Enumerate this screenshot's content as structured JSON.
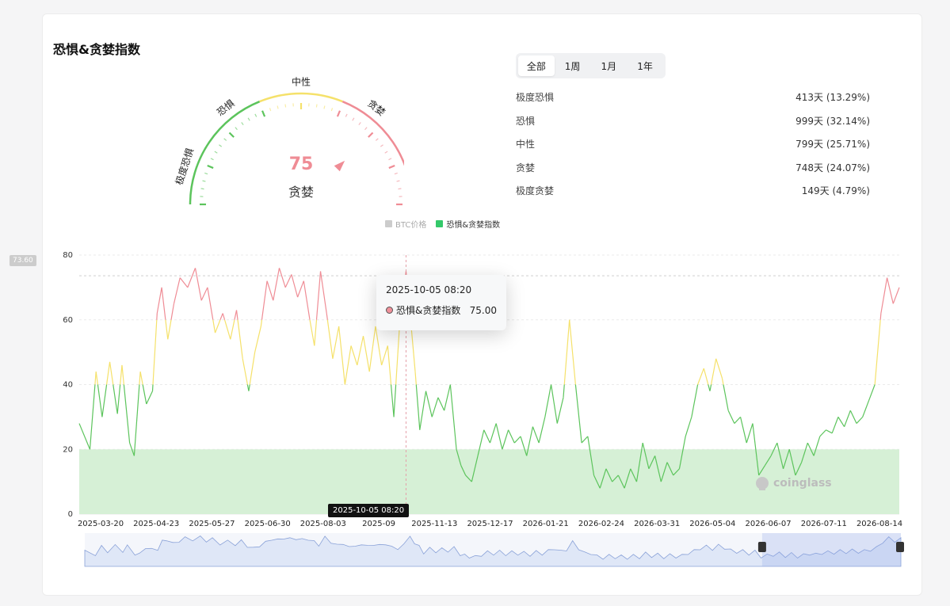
{
  "title": "恐惧&贪婪指数",
  "gauge": {
    "value": "75",
    "label": "贪婪",
    "zones": [
      "极度恐惧",
      "恐惧",
      "中性",
      "贪婪",
      "极度贪婪"
    ]
  },
  "tabs": [
    {
      "label": "全部",
      "active": true
    },
    {
      "label": "1周",
      "active": false
    },
    {
      "label": "1月",
      "active": false
    },
    {
      "label": "1年",
      "active": false
    }
  ],
  "stats": [
    {
      "name": "极度恐惧",
      "value": "413天 (13.29%)"
    },
    {
      "name": "恐惧",
      "value": "999天 (32.14%)"
    },
    {
      "name": "中性",
      "value": "799天 (25.71%)"
    },
    {
      "name": "贪婪",
      "value": "748天 (24.07%)"
    },
    {
      "name": "极度贪婪",
      "value": "149天 (4.79%)"
    }
  ],
  "tooltip": {
    "time": "2025-10-05 08:20",
    "series": "恐惧&贪婪指数",
    "value": "75.00"
  },
  "crosshair_x_label": "2025-10-05 08:20",
  "crosshair_y_label": "73.60",
  "watermark": "coinglass",
  "colors": {
    "fear": "#5cc45c",
    "neutral": "#f5e16a",
    "greed": "#ef8c95",
    "band": "#d6f0d6",
    "legend_green": "#34c96a",
    "legend_gray": "#cccccc"
  },
  "chart_data": {
    "type": "line",
    "legend": [
      {
        "name": "BTC价格",
        "active": false
      },
      {
        "name": "恐惧&贪婪指数",
        "active": true
      }
    ],
    "ylim": [
      0,
      80
    ],
    "y_ticks": [
      0,
      20,
      40,
      60,
      80
    ],
    "x_ticks": [
      "2025-03-20",
      "2025-04-23",
      "2025-05-27",
      "2025-06-30",
      "2025-08-03",
      "2025-09",
      "2025-11-13",
      "2025-12-17",
      "2026-01-21",
      "2026-02-24",
      "2026-03-31",
      "2026-05-04",
      "2026-06-07",
      "2026-07-11",
      "2026-08-14"
    ],
    "x_range": [
      "2025-03-05",
      "2026-08-24"
    ],
    "thresholds": {
      "fear_below": 40,
      "greed_above": 60,
      "band_top": 20
    },
    "series": [
      {
        "name": "恐惧&贪婪指数",
        "points": [
          [
            "2025-03-05",
            28
          ],
          [
            "2025-03-12",
            20
          ],
          [
            "2025-03-16",
            44
          ],
          [
            "2025-03-20",
            30
          ],
          [
            "2025-03-25",
            47
          ],
          [
            "2025-03-30",
            31
          ],
          [
            "2025-04-02",
            46
          ],
          [
            "2025-04-07",
            22
          ],
          [
            "2025-04-10",
            18
          ],
          [
            "2025-04-14",
            44
          ],
          [
            "2025-04-18",
            34
          ],
          [
            "2025-04-22",
            38
          ],
          [
            "2025-04-25",
            62
          ],
          [
            "2025-04-28",
            70
          ],
          [
            "2025-05-02",
            54
          ],
          [
            "2025-05-06",
            65
          ],
          [
            "2025-05-10",
            73
          ],
          [
            "2025-05-15",
            70
          ],
          [
            "2025-05-20",
            76
          ],
          [
            "2025-05-24",
            66
          ],
          [
            "2025-05-28",
            70
          ],
          [
            "2025-06-02",
            56
          ],
          [
            "2025-06-07",
            62
          ],
          [
            "2025-06-12",
            54
          ],
          [
            "2025-06-16",
            63
          ],
          [
            "2025-06-20",
            48
          ],
          [
            "2025-06-24",
            38
          ],
          [
            "2025-06-28",
            50
          ],
          [
            "2025-07-02",
            58
          ],
          [
            "2025-07-06",
            72
          ],
          [
            "2025-07-10",
            66
          ],
          [
            "2025-07-14",
            76
          ],
          [
            "2025-07-18",
            70
          ],
          [
            "2025-07-22",
            74
          ],
          [
            "2025-07-26",
            67
          ],
          [
            "2025-07-30",
            72
          ],
          [
            "2025-08-03",
            60
          ],
          [
            "2025-08-06",
            52
          ],
          [
            "2025-08-10",
            75
          ],
          [
            "2025-08-14",
            62
          ],
          [
            "2025-08-18",
            48
          ],
          [
            "2025-08-22",
            58
          ],
          [
            "2025-08-26",
            40
          ],
          [
            "2025-08-30",
            52
          ],
          [
            "2025-09-03",
            46
          ],
          [
            "2025-09-07",
            55
          ],
          [
            "2025-09-11",
            44
          ],
          [
            "2025-09-15",
            58
          ],
          [
            "2025-09-19",
            46
          ],
          [
            "2025-09-23",
            52
          ],
          [
            "2025-09-27",
            30
          ],
          [
            "2025-10-01",
            60
          ],
          [
            "2025-10-05",
            75
          ],
          [
            "2025-10-08",
            60
          ],
          [
            "2025-10-11",
            44
          ],
          [
            "2025-10-14",
            26
          ],
          [
            "2025-10-18",
            38
          ],
          [
            "2025-10-22",
            30
          ],
          [
            "2025-10-26",
            36
          ],
          [
            "2025-10-30",
            32
          ],
          [
            "2025-11-03",
            40
          ],
          [
            "2025-11-07",
            20
          ],
          [
            "2025-11-10",
            15
          ],
          [
            "2025-11-13",
            12
          ],
          [
            "2025-11-17",
            10
          ],
          [
            "2025-11-21",
            18
          ],
          [
            "2025-11-25",
            26
          ],
          [
            "2025-11-29",
            22
          ],
          [
            "2025-12-03",
            28
          ],
          [
            "2025-12-07",
            20
          ],
          [
            "2025-12-11",
            26
          ],
          [
            "2025-12-15",
            22
          ],
          [
            "2025-12-19",
            24
          ],
          [
            "2025-12-23",
            18
          ],
          [
            "2025-12-27",
            27
          ],
          [
            "2025-12-31",
            22
          ],
          [
            "2026-01-04",
            30
          ],
          [
            "2026-01-08",
            40
          ],
          [
            "2026-01-12",
            28
          ],
          [
            "2026-01-16",
            36
          ],
          [
            "2026-01-20",
            60
          ],
          [
            "2026-01-24",
            40
          ],
          [
            "2026-01-28",
            22
          ],
          [
            "2026-02-01",
            24
          ],
          [
            "2026-02-05",
            12
          ],
          [
            "2026-02-09",
            8
          ],
          [
            "2026-02-13",
            14
          ],
          [
            "2026-02-17",
            10
          ],
          [
            "2026-02-21",
            12
          ],
          [
            "2026-02-25",
            8
          ],
          [
            "2026-03-01",
            14
          ],
          [
            "2026-03-05",
            10
          ],
          [
            "2026-03-09",
            22
          ],
          [
            "2026-03-13",
            14
          ],
          [
            "2026-03-17",
            18
          ],
          [
            "2026-03-21",
            10
          ],
          [
            "2026-03-25",
            16
          ],
          [
            "2026-03-29",
            12
          ],
          [
            "2026-04-02",
            14
          ],
          [
            "2026-04-06",
            24
          ],
          [
            "2026-04-10",
            30
          ],
          [
            "2026-04-14",
            40
          ],
          [
            "2026-04-18",
            45
          ],
          [
            "2026-04-22",
            38
          ],
          [
            "2026-04-26",
            48
          ],
          [
            "2026-04-30",
            42
          ],
          [
            "2026-05-04",
            32
          ],
          [
            "2026-05-08",
            28
          ],
          [
            "2026-05-12",
            30
          ],
          [
            "2026-05-16",
            22
          ],
          [
            "2026-05-20",
            28
          ],
          [
            "2026-05-24",
            12
          ],
          [
            "2026-05-28",
            15
          ],
          [
            "2026-06-01",
            18
          ],
          [
            "2026-06-05",
            22
          ],
          [
            "2026-06-09",
            14
          ],
          [
            "2026-06-13",
            20
          ],
          [
            "2026-06-17",
            12
          ],
          [
            "2026-06-21",
            16
          ],
          [
            "2026-06-25",
            22
          ],
          [
            "2026-06-29",
            18
          ],
          [
            "2026-07-03",
            24
          ],
          [
            "2026-07-07",
            26
          ],
          [
            "2026-07-11",
            25
          ],
          [
            "2026-07-15",
            30
          ],
          [
            "2026-07-19",
            27
          ],
          [
            "2026-07-23",
            32
          ],
          [
            "2026-07-27",
            28
          ],
          [
            "2026-07-31",
            30
          ],
          [
            "2026-08-04",
            35
          ],
          [
            "2026-08-08",
            40
          ],
          [
            "2026-08-12",
            62
          ],
          [
            "2026-08-16",
            73
          ],
          [
            "2026-08-20",
            65
          ],
          [
            "2026-08-24",
            70
          ]
        ]
      }
    ],
    "navigator": {
      "window_start_fraction": 0.83,
      "window_end_fraction": 1.0
    }
  }
}
